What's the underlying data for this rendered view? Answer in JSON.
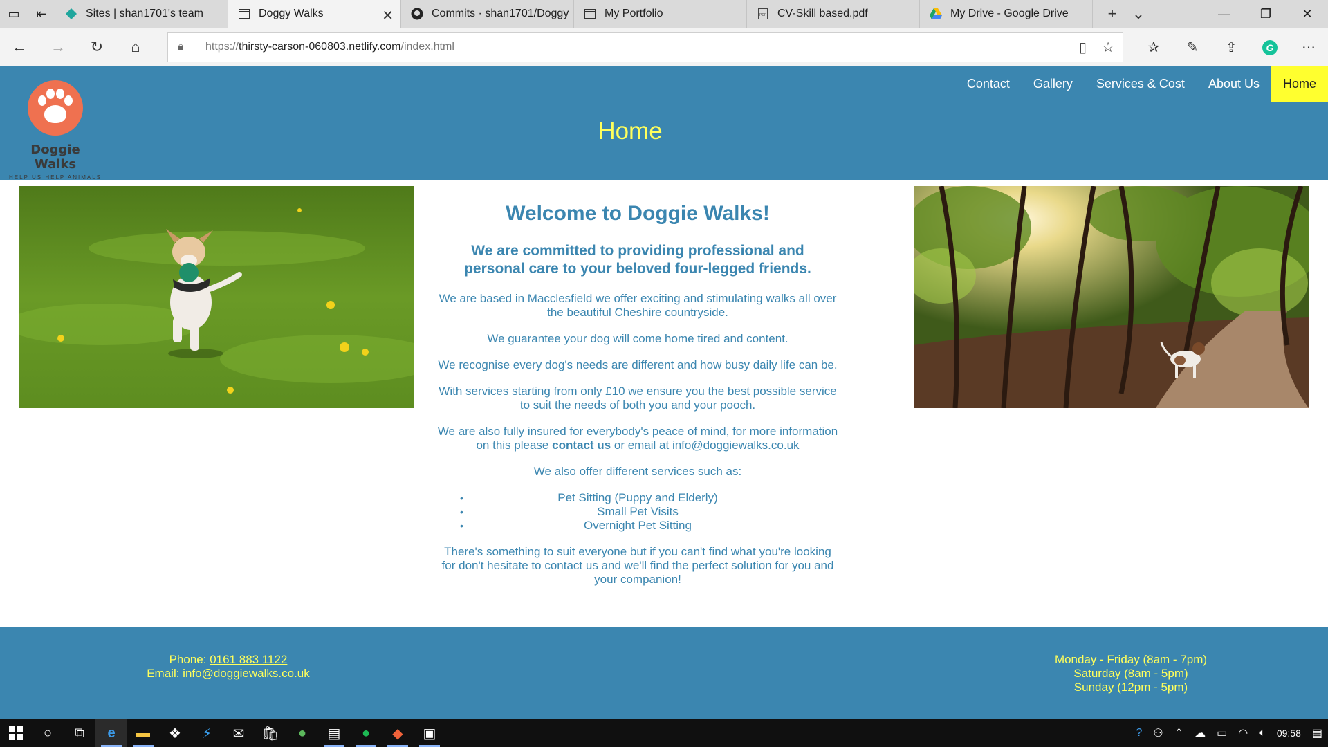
{
  "browser": {
    "tabs": [
      {
        "title": "Sites | shan1701's team",
        "icon": "netlify-icon",
        "active": false
      },
      {
        "title": "Doggy Walks",
        "icon": "page-icon",
        "active": true
      },
      {
        "title": "Commits · shan1701/Doggy",
        "icon": "github-icon",
        "active": false
      },
      {
        "title": "My Portfolio",
        "icon": "page-icon",
        "active": false
      },
      {
        "title": "CV-Skill based.pdf",
        "icon": "pdf-icon",
        "active": false
      },
      {
        "title": "My Drive - Google Drive",
        "icon": "google-drive-icon",
        "active": false
      }
    ],
    "url": {
      "proto": "https://",
      "host": "thirsty-carson-060803.netlify.com",
      "path": "/index.html"
    }
  },
  "site": {
    "logo_title": "Doggie Walks",
    "logo_subtitle": "HELP US HELP ANIMALS",
    "menu": [
      "Contact",
      "Gallery",
      "Services & Cost",
      "About Us",
      "Home"
    ],
    "current_menu": "Home",
    "page_title": "Home",
    "welcome": "Welcome to Doggie Walks!",
    "tagline": "We are committed to providing professional and personal care to your beloved four-legged friends.",
    "para1": "We are based in Macclesfield we offer exciting and stimulating walks all over the beautiful Cheshire countryside.",
    "para2": "We guarantee your dog will come home tired and content.",
    "para3": "We recognise every dog's needs are different and how busy daily life can be.",
    "para4": "With services starting from only £10 we ensure you the best possible service to suit the needs of both you and your pooch.",
    "para5_pre": "We are also fully insured for everybody's peace of mind, for more information on this please ",
    "para5_link": "contact us",
    "para5_post": " or email at info@doggiewalks.co.uk",
    "services_intro": "We also offer different services such as:",
    "services": [
      "Pet Sitting (Puppy and Elderly)",
      "Small Pet Visits",
      "Overnight Pet Sitting"
    ],
    "closing": "There's something to suit everyone but if you can't find what you're looking for don't hesitate to contact us and we'll find the perfect solution for you and your companion!",
    "footer": {
      "phone_label": "Phone: ",
      "phone": "0161 883 1122",
      "email": "Email: info@doggiewalks.co.uk",
      "hours": [
        "Monday - Friday (8am - 7pm)",
        "Saturday (8am - 5pm)",
        "Sunday (12pm - 5pm)"
      ]
    }
  },
  "taskbar": {
    "time": "09:58"
  },
  "colors": {
    "brand_blue": "#3b86b0",
    "accent_yellow": "#ffff5c",
    "logo_orange": "#ef7150"
  }
}
